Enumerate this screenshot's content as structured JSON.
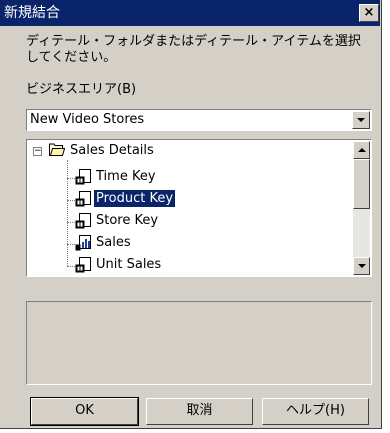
{
  "window": {
    "title": "新規結合",
    "close_glyph": "×"
  },
  "instruction": "ディテール・フォルダまたはディテール・アイテムを選択してください。",
  "business_area": {
    "label": "ビジネスエリア(B)",
    "selected": "New Video Stores"
  },
  "tree": {
    "folder": "Sales Details",
    "items": [
      {
        "label": "Time Key",
        "selected": false
      },
      {
        "label": "Product Key",
        "selected": true
      },
      {
        "label": "Store Key",
        "selected": false
      },
      {
        "label": "Sales",
        "selected": false
      },
      {
        "label": "Unit Sales",
        "selected": false
      }
    ]
  },
  "buttons": {
    "ok": "OK",
    "cancel": "取消",
    "help": "ヘルプ(H)"
  },
  "colors": {
    "title_bar": "#0a246a",
    "face": "#d4d0c8",
    "selection": "#0a246a"
  }
}
